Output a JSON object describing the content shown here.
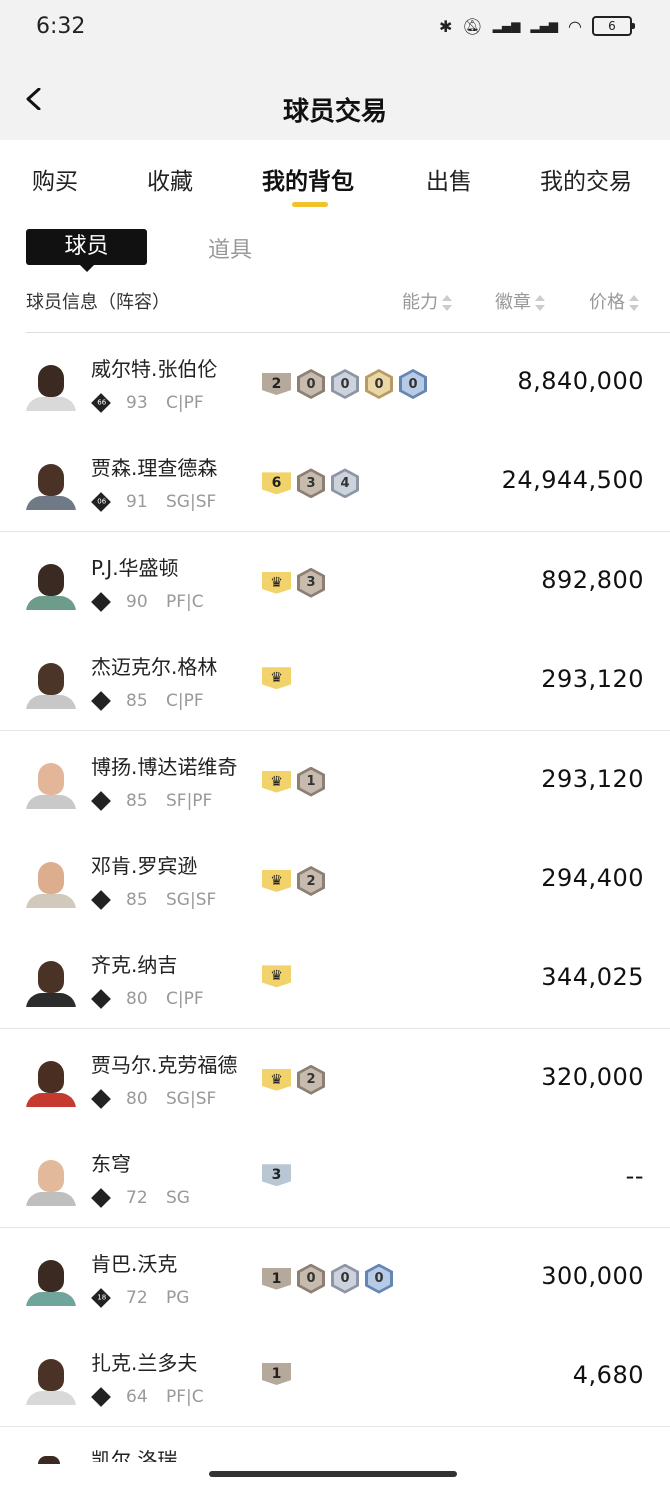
{
  "status": {
    "time": "6:32",
    "battery": "6"
  },
  "header": {
    "title": "球员交易"
  },
  "tabs": [
    "购买",
    "收藏",
    "我的背包",
    "出售",
    "我的交易"
  ],
  "segments": {
    "active": "球员",
    "inactive": "道具"
  },
  "columns": {
    "info": "球员信息（阵容）",
    "ability": "能力",
    "badges": "徽章",
    "price": "价格"
  },
  "players": [
    {
      "name": "威尔特.张伯伦",
      "tier": "66",
      "ovr": "93",
      "pos": "C|PF",
      "price": "8,840,000",
      "badges": [
        {
          "kind": "flat",
          "color": "brown",
          "label": "2"
        },
        {
          "kind": "hex",
          "color": "brown",
          "label": "0"
        },
        {
          "kind": "hex",
          "color": "silver",
          "label": "0"
        },
        {
          "kind": "hex",
          "color": "gold",
          "label": "0"
        },
        {
          "kind": "hex",
          "color": "blue",
          "label": "0"
        }
      ],
      "skin": "#3a2a22",
      "jersey": "#d9d9d9"
    },
    {
      "name": "贾森.理查德森",
      "tier": "06",
      "ovr": "91",
      "pos": "SG|SF",
      "price": "24,944,500",
      "badges": [
        {
          "kind": "flat",
          "color": "gold",
          "label": "6"
        },
        {
          "kind": "hex",
          "color": "brown",
          "label": "3"
        },
        {
          "kind": "hex",
          "color": "silver",
          "label": "4"
        }
      ],
      "skin": "#4a3226",
      "jersey": "#6f7a86"
    },
    {
      "name": "P.J.华盛顿",
      "tier": "",
      "ovr": "90",
      "pos": "PF|C",
      "price": "892,800",
      "badges": [
        {
          "kind": "flat",
          "color": "gold",
          "label": "♛"
        },
        {
          "kind": "hex",
          "color": "brown",
          "label": "3"
        }
      ],
      "skin": "#3b2a21",
      "jersey": "#6e9c8a"
    },
    {
      "name": "杰迈克尔.格林",
      "tier": "",
      "ovr": "85",
      "pos": "C|PF",
      "price": "293,120",
      "badges": [
        {
          "kind": "flat",
          "color": "gold",
          "label": "♛"
        }
      ],
      "skin": "#4b3528",
      "jersey": "#c7c7c7"
    },
    {
      "name": "博扬.博达诺维奇",
      "tier": "",
      "ovr": "85",
      "pos": "SF|PF",
      "price": "293,120",
      "badges": [
        {
          "kind": "flat",
          "color": "gold",
          "label": "♛"
        },
        {
          "kind": "hex",
          "color": "brown",
          "label": "1"
        }
      ],
      "skin": "#e3b69a",
      "jersey": "#c9c9c9"
    },
    {
      "name": "邓肯.罗宾逊",
      "tier": "",
      "ovr": "85",
      "pos": "SG|SF",
      "price": "294,400",
      "badges": [
        {
          "kind": "flat",
          "color": "gold",
          "label": "♛"
        },
        {
          "kind": "hex",
          "color": "brown",
          "label": "2"
        }
      ],
      "skin": "#dcae8e",
      "jersey": "#d2c9bd"
    },
    {
      "name": "齐克.纳吉",
      "tier": "",
      "ovr": "80",
      "pos": "C|PF",
      "price": "344,025",
      "badges": [
        {
          "kind": "flat",
          "color": "gold",
          "label": "♛"
        }
      ],
      "skin": "#4a3226",
      "jersey": "#2c2c2c"
    },
    {
      "name": "贾马尔.克劳福德",
      "tier": "",
      "ovr": "80",
      "pos": "SG|SF",
      "price": "320,000",
      "badges": [
        {
          "kind": "flat",
          "color": "gold",
          "label": "♛"
        },
        {
          "kind": "hex",
          "color": "brown",
          "label": "2"
        }
      ],
      "skin": "#4a2e22",
      "jersey": "#c43a2f"
    },
    {
      "name": "东穹",
      "tier": "",
      "ovr": "72",
      "pos": "SG",
      "price": "--",
      "badges": [
        {
          "kind": "flat",
          "color": "blue",
          "label": "3"
        }
      ],
      "skin": "#e3b99c",
      "jersey": "#bfbfbf"
    },
    {
      "name": "肯巴.沃克",
      "tier": "18",
      "ovr": "72",
      "pos": "PG",
      "price": "300,000",
      "badges": [
        {
          "kind": "flat",
          "color": "brown",
          "label": "1"
        },
        {
          "kind": "hex",
          "color": "brown",
          "label": "0"
        },
        {
          "kind": "hex",
          "color": "silver",
          "label": "0"
        },
        {
          "kind": "hex",
          "color": "blue",
          "label": "0"
        }
      ],
      "skin": "#3b2a21",
      "jersey": "#6fa59a"
    },
    {
      "name": "扎克.兰多夫",
      "tier": "",
      "ovr": "64",
      "pos": "PF|C",
      "price": "4,680",
      "badges": [
        {
          "kind": "flat",
          "color": "brown",
          "label": "1"
        }
      ],
      "skin": "#4a3226",
      "jersey": "#d9d9d9"
    }
  ],
  "partial_row": {
    "name": "凯尔.洛瑞"
  }
}
